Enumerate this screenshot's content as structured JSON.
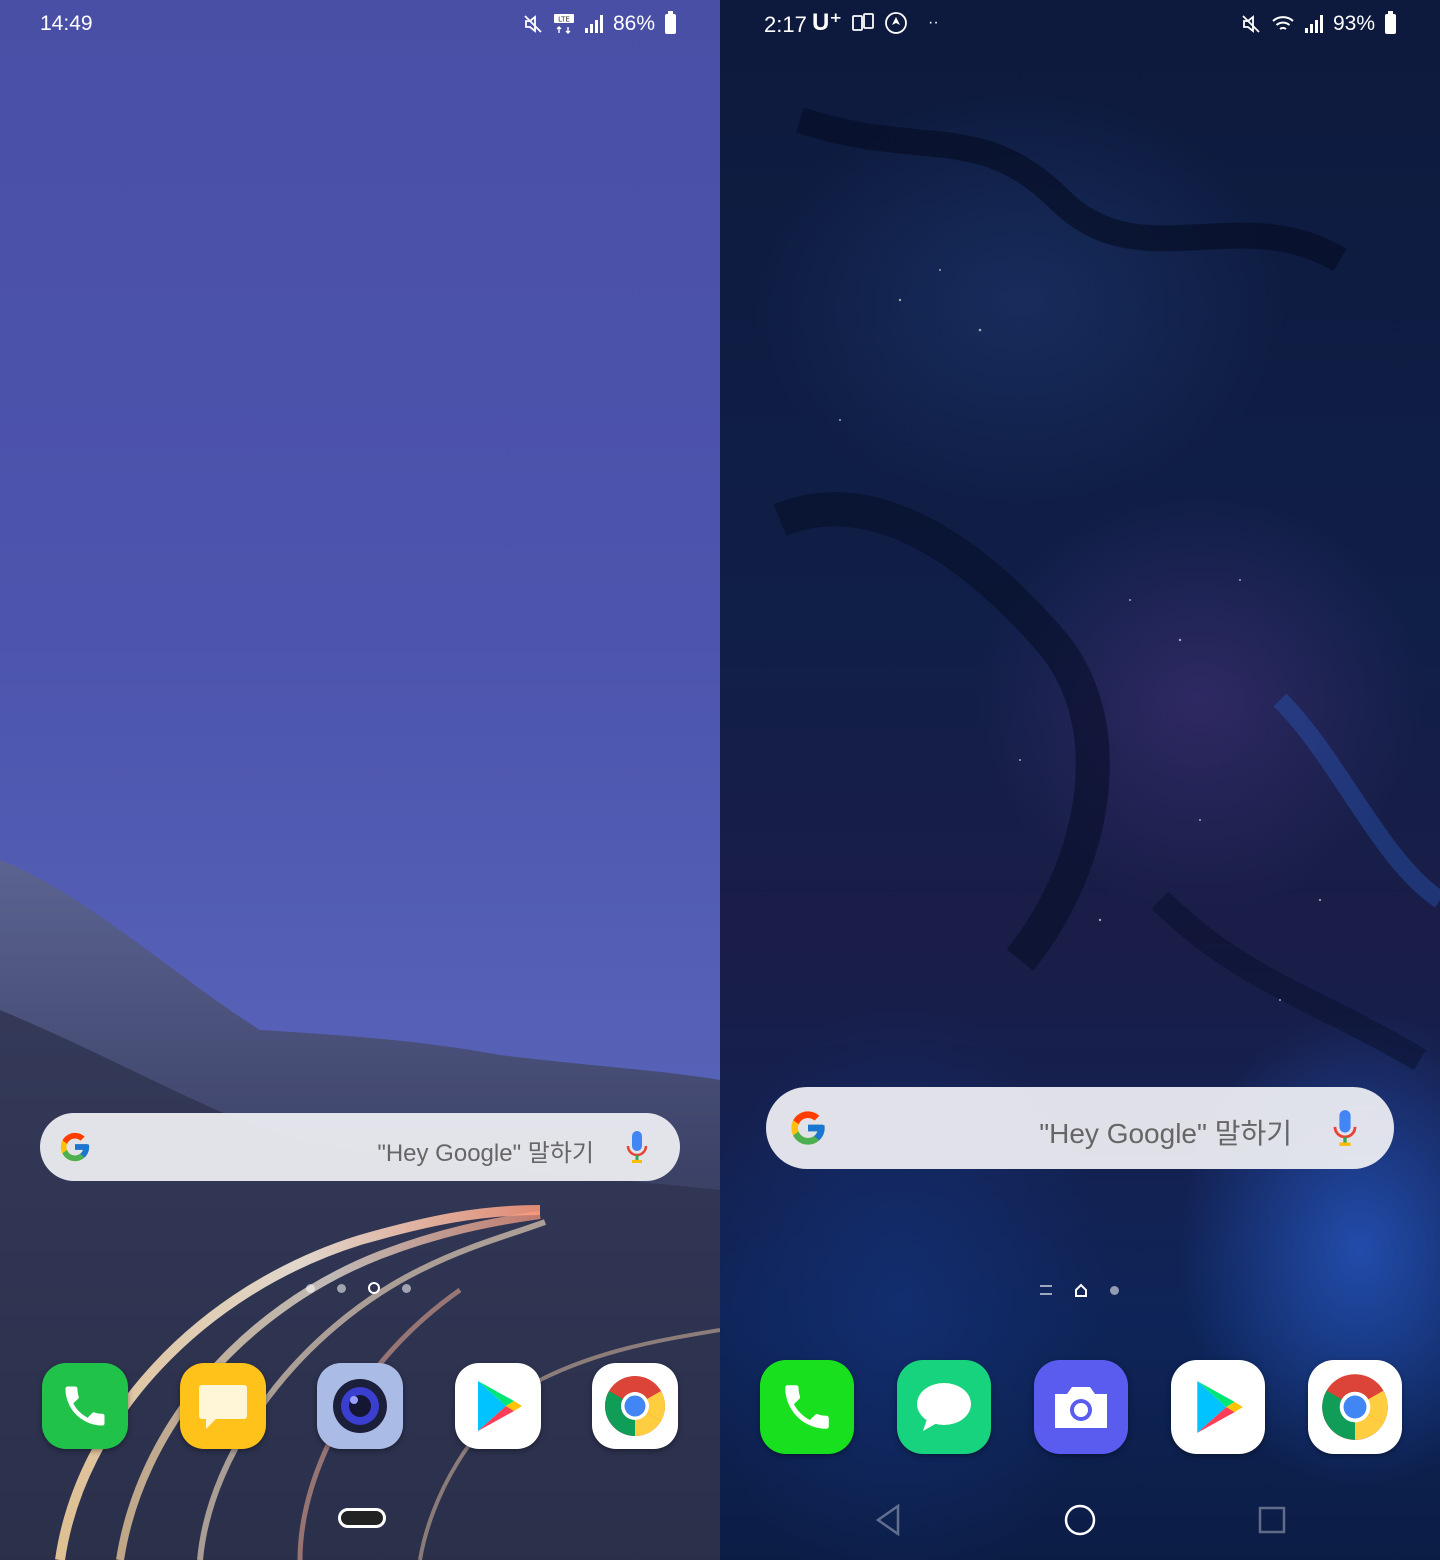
{
  "left": {
    "status": {
      "time": "14:49",
      "battery": "86%",
      "icons": [
        "mute-icon",
        "lte-icon",
        "signal-icon",
        "battery-icon"
      ]
    },
    "search": {
      "hint": "\"Hey Google\" 말하기",
      "icons": [
        "google-g-icon",
        "mic-icon"
      ]
    },
    "pager": {
      "pages": 4,
      "current": 3
    },
    "dock": [
      {
        "name": "phone",
        "icon": "phone-icon",
        "color": "#21c24a"
      },
      {
        "name": "messages",
        "icon": "message-icon",
        "color": "#ffc21a"
      },
      {
        "name": "camera",
        "icon": "camera-icon",
        "color": "#aabbe6"
      },
      {
        "name": "play-store",
        "icon": "play-store-icon",
        "color": "#ffffff"
      },
      {
        "name": "chrome",
        "icon": "chrome-icon",
        "color": "#ffffff"
      }
    ]
  },
  "right": {
    "status": {
      "time": "2:17",
      "carrier": "U⁺",
      "battery": "93%",
      "icons": [
        "carrier-icon",
        "screen-icon",
        "location-icon",
        "more-icon",
        "mute-icon",
        "wifi-icon",
        "signal-icon",
        "battery-icon"
      ]
    },
    "search": {
      "hint": "\"Hey Google\" 말하기",
      "icons": [
        "google-g-icon",
        "mic-icon"
      ]
    },
    "pager": {
      "items": [
        "menu",
        "home",
        "page"
      ]
    },
    "dock": [
      {
        "name": "phone",
        "icon": "phone-icon",
        "color": "#19e01e"
      },
      {
        "name": "messages",
        "icon": "message-icon",
        "color": "#18d37e"
      },
      {
        "name": "camera",
        "icon": "camera-icon",
        "color": "#5a5cf0"
      },
      {
        "name": "play-store",
        "icon": "play-store-icon",
        "color": "#ffffff"
      },
      {
        "name": "chrome",
        "icon": "chrome-icon",
        "color": "#ffffff"
      }
    ],
    "nav": [
      "back-icon",
      "home-icon",
      "recents-icon"
    ]
  }
}
